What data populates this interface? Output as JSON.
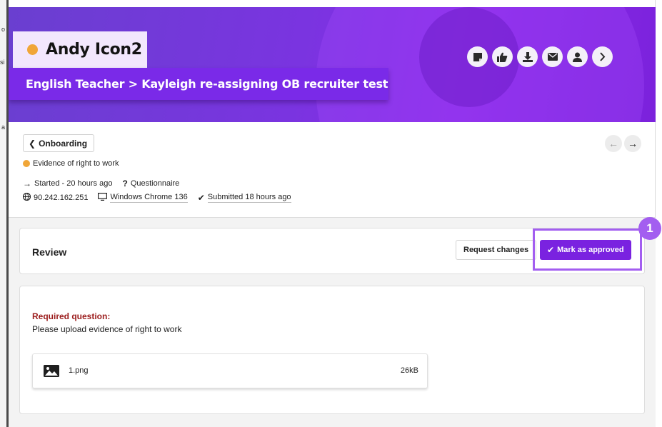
{
  "background": {
    "fragments": [
      "o",
      "si",
      "a"
    ]
  },
  "header": {
    "candidate_name": "Andy Icon2",
    "status_color": "#f0a638",
    "job_path": "English Teacher > Kayleigh re-assigning OB recruiter test",
    "actions": [
      {
        "icon": "note-icon"
      },
      {
        "icon": "thumbs-up-icon"
      },
      {
        "icon": "download-icon"
      },
      {
        "icon": "envelope-icon"
      },
      {
        "icon": "person-icon"
      },
      {
        "icon": "chevron-right-icon"
      }
    ]
  },
  "info": {
    "back_label": "Onboarding",
    "step_name": "Evidence of right to work",
    "started": "Started - 20 hours ago",
    "type": "Questionnaire",
    "ip": "90.242.162.251",
    "device": "Windows Chrome 136",
    "submitted": "Submitted 18 hours ago",
    "prev_arrow": "←",
    "next_arrow": "→"
  },
  "review": {
    "title": "Review",
    "request_changes_label": "Request changes",
    "approve_label": "Mark as approved",
    "step_badge": "1",
    "accent": "#7a22e0",
    "highlight": "#a35ef0"
  },
  "question": {
    "label": "Required question:",
    "text": "Please upload evidence of right to work",
    "file": {
      "name": "1.png",
      "size": "26kB"
    }
  }
}
